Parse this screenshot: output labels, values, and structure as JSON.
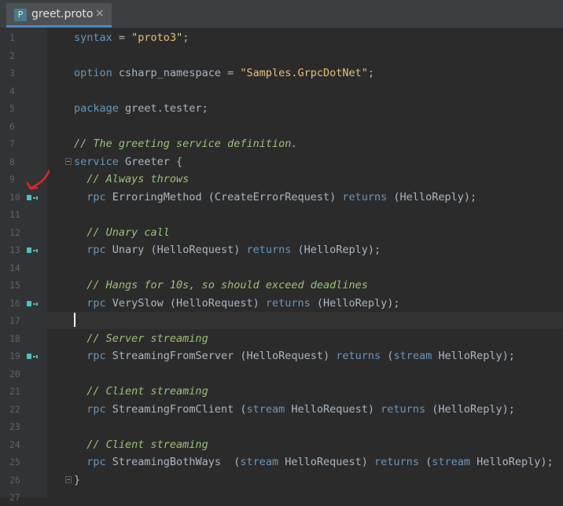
{
  "tab": {
    "icon_letter": "P",
    "title": "greet.proto",
    "close_glyph": "×"
  },
  "annotation_color": "#e0262a",
  "gutter_icon": "implementation-marker-icon",
  "lines": [
    {
      "n": "1",
      "tokens": [
        [
          "kw",
          "syntax"
        ],
        [
          "t",
          " = "
        ],
        [
          "str",
          "\"proto3\""
        ],
        [
          "t",
          ";"
        ]
      ]
    },
    {
      "n": "2",
      "tokens": []
    },
    {
      "n": "3",
      "tokens": [
        [
          "kw",
          "option"
        ],
        [
          "t",
          " csharp_namespace = "
        ],
        [
          "str",
          "\"Samples.GrpcDotNet\""
        ],
        [
          "t",
          ";"
        ]
      ]
    },
    {
      "n": "4",
      "tokens": []
    },
    {
      "n": "5",
      "tokens": [
        [
          "kw",
          "package"
        ],
        [
          "t",
          " greet.tester;"
        ]
      ]
    },
    {
      "n": "6",
      "tokens": []
    },
    {
      "n": "7",
      "tokens": [
        [
          "cmt",
          "// The greeting service definition."
        ]
      ]
    },
    {
      "n": "8",
      "tokens": [
        [
          "kw",
          "service"
        ],
        [
          "t",
          " Greeter {"
        ]
      ],
      "fold": true
    },
    {
      "n": "9",
      "tokens": [
        [
          "t",
          "  "
        ],
        [
          "cmt",
          "// Always throws"
        ]
      ]
    },
    {
      "n": "10",
      "tokens": [
        [
          "t",
          "  "
        ],
        [
          "kw",
          "rpc"
        ],
        [
          "t",
          " ErroringMethod (CreateErrorRequest) "
        ],
        [
          "kw",
          "returns"
        ],
        [
          "t",
          " (HelloReply);"
        ]
      ],
      "marker": true
    },
    {
      "n": "11",
      "tokens": []
    },
    {
      "n": "12",
      "tokens": [
        [
          "t",
          "  "
        ],
        [
          "cmt",
          "// Unary call"
        ]
      ]
    },
    {
      "n": "13",
      "tokens": [
        [
          "t",
          "  "
        ],
        [
          "kw",
          "rpc"
        ],
        [
          "t",
          " Unary (HelloRequest) "
        ],
        [
          "kw",
          "returns"
        ],
        [
          "t",
          " (HelloReply);"
        ]
      ],
      "marker": true
    },
    {
      "n": "14",
      "tokens": []
    },
    {
      "n": "15",
      "tokens": [
        [
          "t",
          "  "
        ],
        [
          "cmt",
          "// Hangs for 10s, so should exceed deadlines"
        ]
      ]
    },
    {
      "n": "16",
      "tokens": [
        [
          "t",
          "  "
        ],
        [
          "kw",
          "rpc"
        ],
        [
          "t",
          " VerySlow (HelloRequest) "
        ],
        [
          "kw",
          "returns"
        ],
        [
          "t",
          " (HelloReply);"
        ]
      ],
      "marker": true
    },
    {
      "n": "17",
      "tokens": [],
      "current": true
    },
    {
      "n": "18",
      "tokens": [
        [
          "t",
          "  "
        ],
        [
          "cmt",
          "// Server streaming"
        ]
      ]
    },
    {
      "n": "19",
      "tokens": [
        [
          "t",
          "  "
        ],
        [
          "kw",
          "rpc"
        ],
        [
          "t",
          " StreamingFromServer (HelloRequest) "
        ],
        [
          "kw",
          "returns"
        ],
        [
          "t",
          " ("
        ],
        [
          "kw",
          "stream"
        ],
        [
          "t",
          " HelloReply);"
        ]
      ],
      "marker": true
    },
    {
      "n": "20",
      "tokens": []
    },
    {
      "n": "21",
      "tokens": [
        [
          "t",
          "  "
        ],
        [
          "cmt",
          "// Client streaming"
        ]
      ]
    },
    {
      "n": "22",
      "tokens": [
        [
          "t",
          "  "
        ],
        [
          "kw",
          "rpc"
        ],
        [
          "t",
          " StreamingFromClient ("
        ],
        [
          "kw",
          "stream"
        ],
        [
          "t",
          " HelloRequest) "
        ],
        [
          "kw",
          "returns"
        ],
        [
          "t",
          " (HelloReply);"
        ]
      ]
    },
    {
      "n": "23",
      "tokens": []
    },
    {
      "n": "24",
      "tokens": [
        [
          "t",
          "  "
        ],
        [
          "cmt",
          "// Client streaming"
        ]
      ]
    },
    {
      "n": "25",
      "tokens": [
        [
          "t",
          "  "
        ],
        [
          "kw",
          "rpc"
        ],
        [
          "t",
          " StreamingBothWays  ("
        ],
        [
          "kw",
          "stream"
        ],
        [
          "t",
          " HelloRequest) "
        ],
        [
          "kw",
          "returns"
        ],
        [
          "t",
          " ("
        ],
        [
          "kw",
          "stream"
        ],
        [
          "t",
          " HelloReply);"
        ]
      ]
    },
    {
      "n": "26",
      "tokens": [
        [
          "t",
          "}"
        ]
      ],
      "fold": true
    },
    {
      "n": "27",
      "tokens": []
    }
  ]
}
